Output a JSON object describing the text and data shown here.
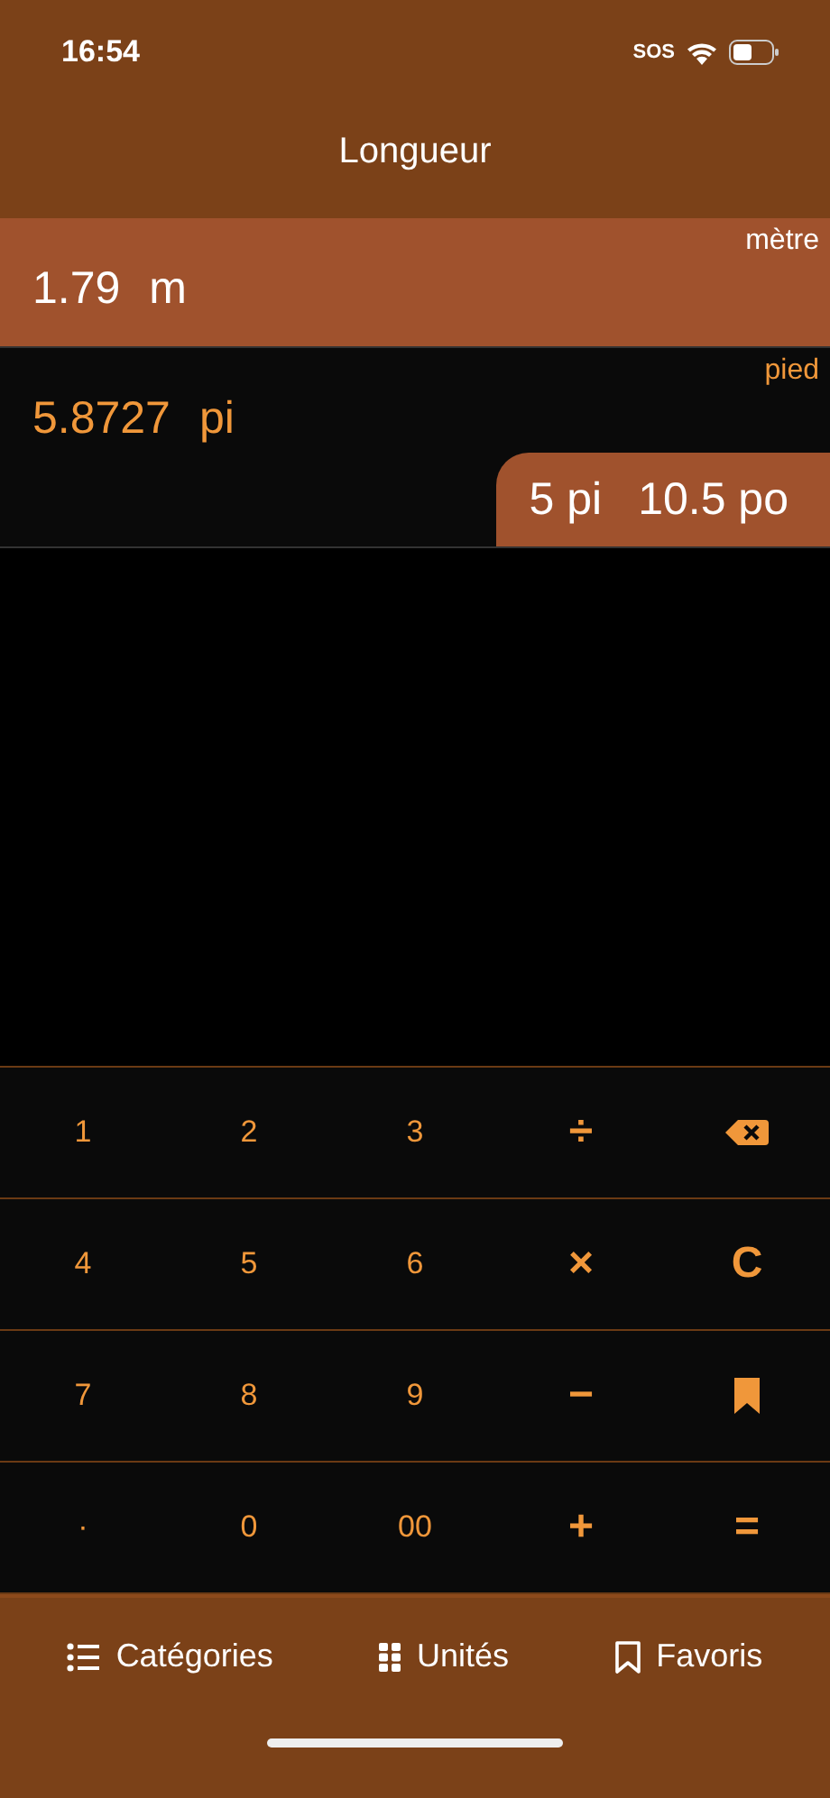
{
  "status_bar": {
    "time": "16:54",
    "carrier": "SOS"
  },
  "title": "Longueur",
  "units": [
    {
      "value": "1.79",
      "symbol": "m",
      "name": "mètre",
      "selected": true
    },
    {
      "value": "5.8727",
      "symbol": "pi",
      "name": "pied",
      "selected": false,
      "compound": [
        "5 pi",
        "10.5 po"
      ]
    }
  ],
  "keypad": [
    {
      "kind": "text",
      "label": "1"
    },
    {
      "kind": "text",
      "label": "2"
    },
    {
      "kind": "text",
      "label": "3"
    },
    {
      "kind": "op",
      "label": "÷"
    },
    {
      "kind": "backspace"
    },
    {
      "kind": "text",
      "label": "4"
    },
    {
      "kind": "text",
      "label": "5"
    },
    {
      "kind": "text",
      "label": "6"
    },
    {
      "kind": "op",
      "label": "×"
    },
    {
      "kind": "op",
      "label": "C"
    },
    {
      "kind": "text",
      "label": "7"
    },
    {
      "kind": "text",
      "label": "8"
    },
    {
      "kind": "text",
      "label": "9"
    },
    {
      "kind": "op",
      "label": "−"
    },
    {
      "kind": "bookmark"
    },
    {
      "kind": "text",
      "label": "·"
    },
    {
      "kind": "text",
      "label": "0"
    },
    {
      "kind": "text",
      "label": "00"
    },
    {
      "kind": "op",
      "label": "+"
    },
    {
      "kind": "op",
      "label": "="
    }
  ],
  "tabs": [
    {
      "kind": "list",
      "label": "Catégories"
    },
    {
      "kind": "grid",
      "label": "Unités"
    },
    {
      "kind": "bookmark",
      "label": "Favoris"
    }
  ]
}
